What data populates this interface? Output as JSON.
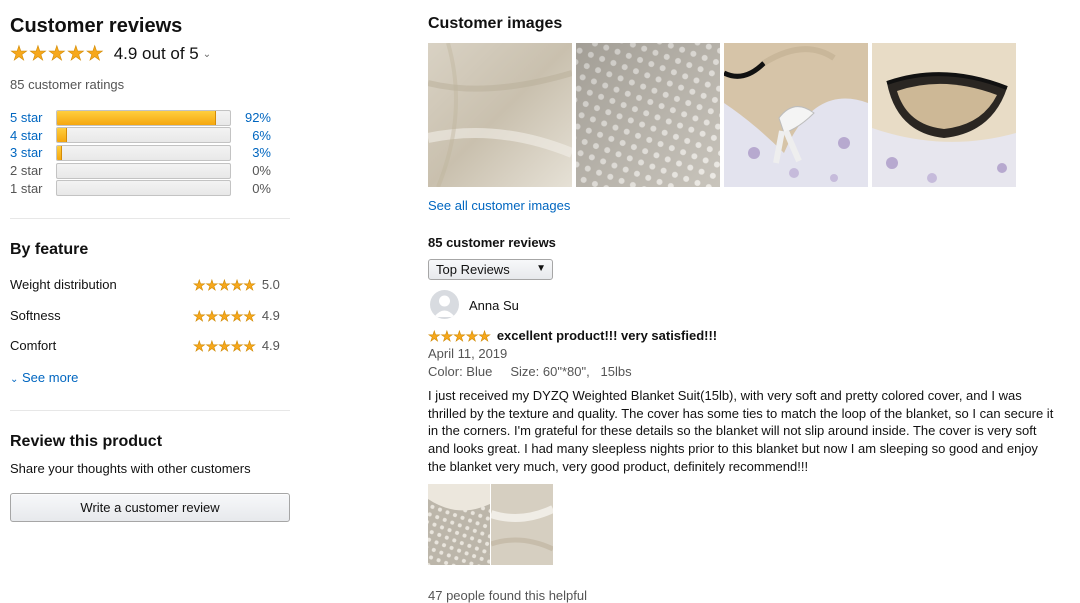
{
  "summary": {
    "title": "Customer reviews",
    "rating_text": "4.9 out of 5",
    "average_rating": 4.9,
    "total_ratings": "85 customer ratings",
    "histogram": [
      {
        "label": "5 star",
        "percent": 92,
        "percent_text": "92%",
        "linked": true
      },
      {
        "label": "4 star",
        "percent": 6,
        "percent_text": "6%",
        "linked": true
      },
      {
        "label": "3 star",
        "percent": 3,
        "percent_text": "3%",
        "linked": true
      },
      {
        "label": "2 star",
        "percent": 0,
        "percent_text": "0%",
        "linked": false
      },
      {
        "label": "1 star",
        "percent": 0,
        "percent_text": "0%",
        "linked": false
      }
    ]
  },
  "features": {
    "title": "By feature",
    "items": [
      {
        "name": "Weight distribution",
        "rating": "5.0"
      },
      {
        "name": "Softness",
        "rating": "4.9"
      },
      {
        "name": "Comfort",
        "rating": "4.9"
      }
    ],
    "see_more": "See more"
  },
  "review_product": {
    "title": "Review this product",
    "subtitle": "Share your thoughts with other customers",
    "button": "Write a customer review"
  },
  "images": {
    "title": "Customer images",
    "see_all": "See all customer images"
  },
  "reviews": {
    "count": "85 customer reviews",
    "sort_selected": "Top Reviews",
    "items": [
      {
        "author": "Anna Su",
        "stars": 5,
        "title": "excellent product!!! very satisfied!!!",
        "date": "April 11, 2019",
        "meta": "Color: Blue     Size: 60\"*80\",   15lbs",
        "body": "I just received my DYZQ Weighted Blanket Suit(15lb), with very soft and pretty colored cover, and I was thrilled by the texture and quality. The cover has some ties to match the loop of the blanket, so I can secure it in the corners. I'm grateful for these details so the blanket will not slip around inside. The cover is very soft and looks great. I had many sleepless nights prior to this blanket but now I am sleeping so good and enjoy the blanket very much, very good product, definitely recommend!!!",
        "helpful": "47 people found this helpful"
      }
    ]
  },
  "colors": {
    "star": "#f7a81b",
    "link": "#0066c0",
    "bar_fill": "#f5a70f"
  }
}
